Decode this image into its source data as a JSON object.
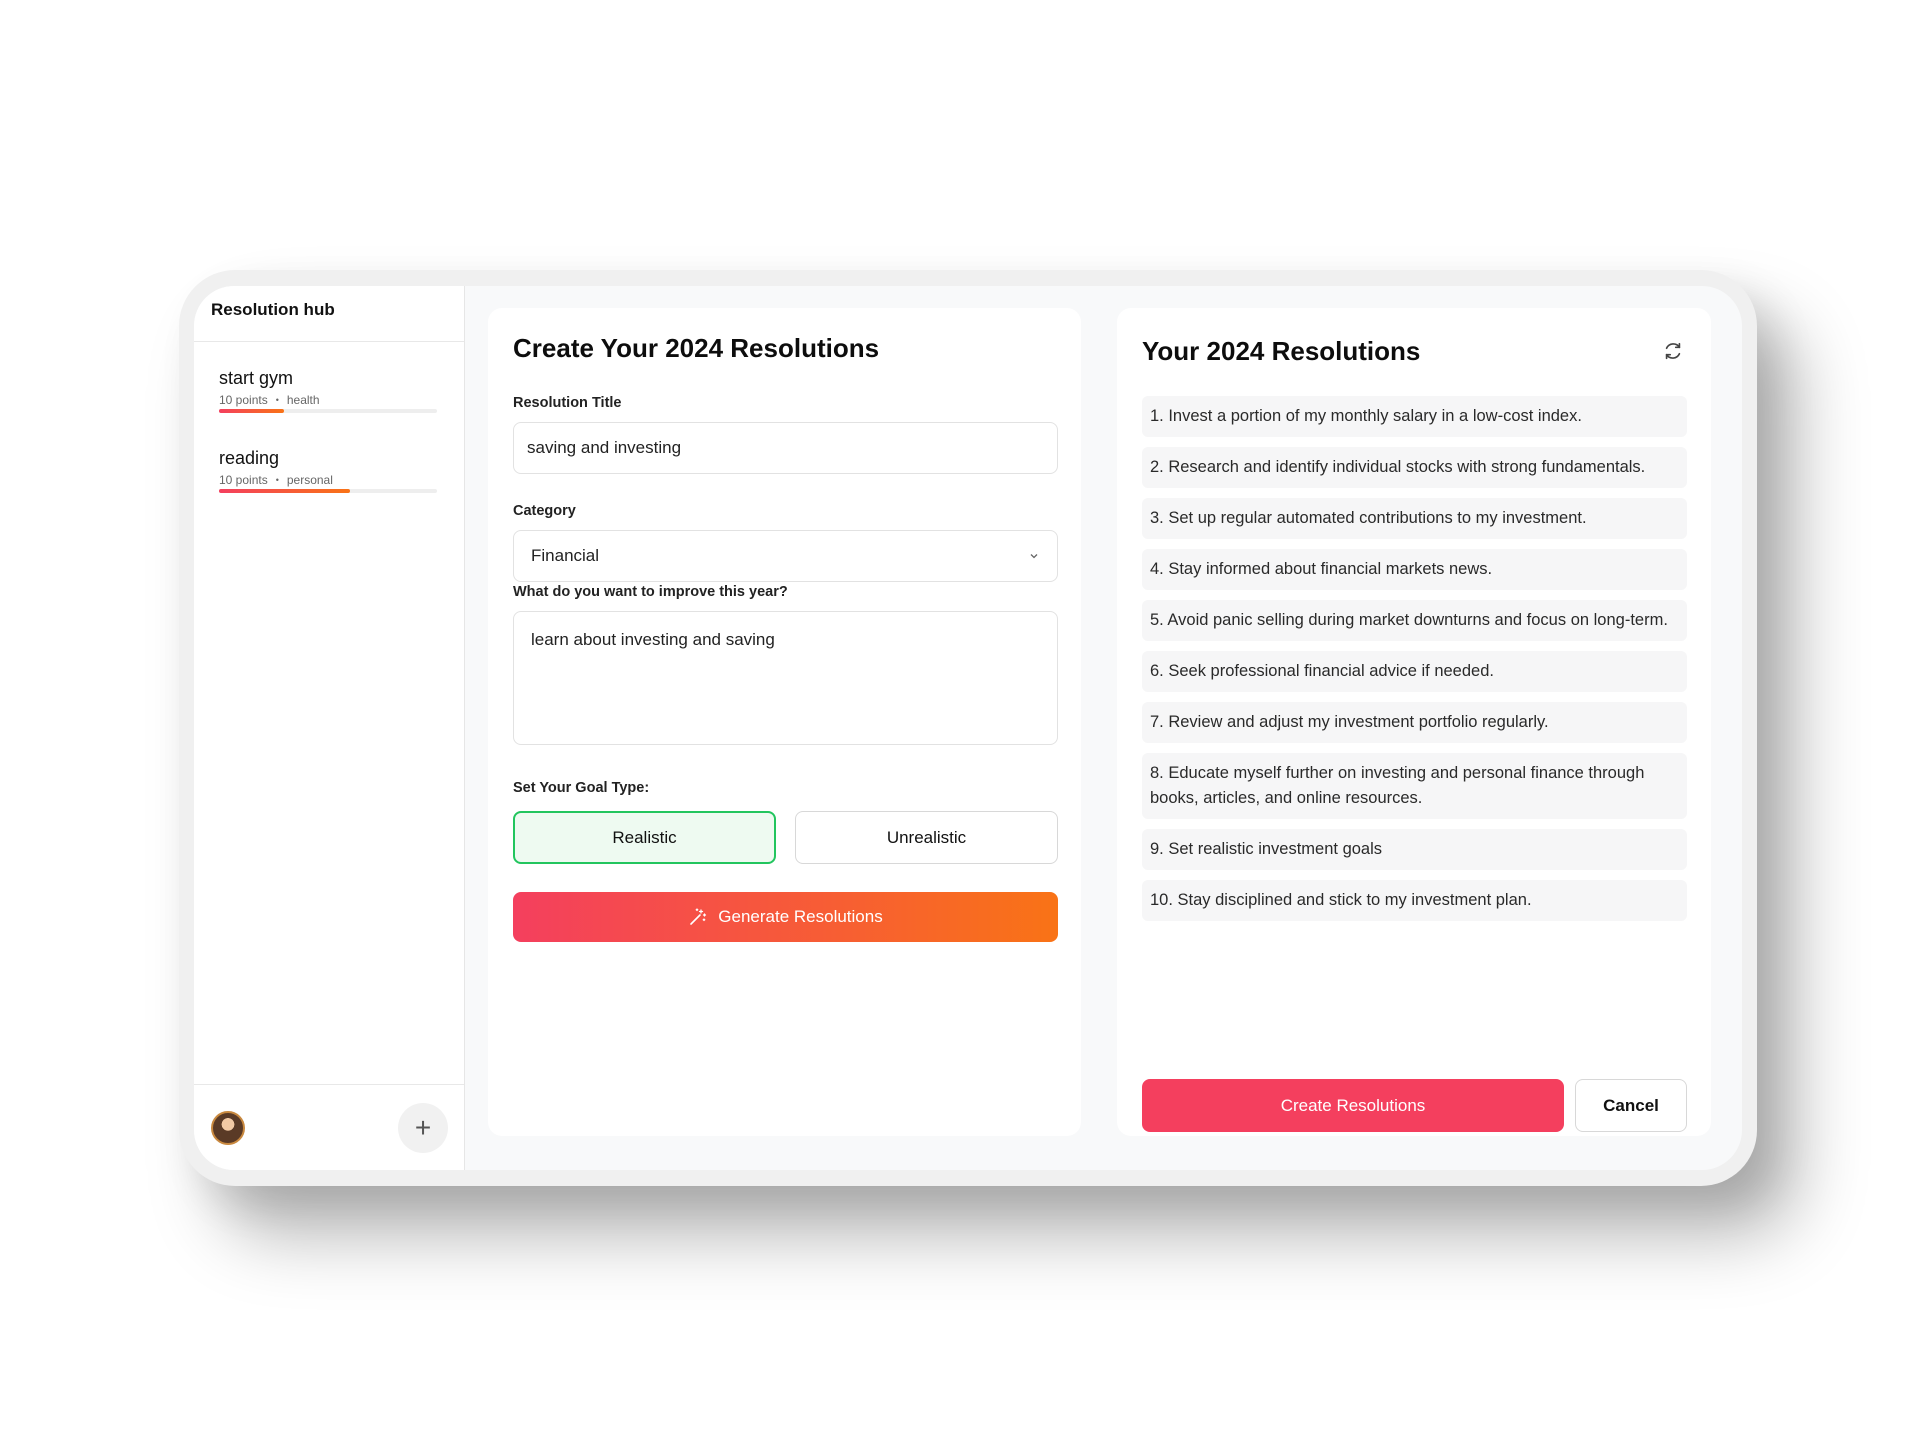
{
  "sidebar": {
    "title": "Resolution hub",
    "items": [
      {
        "name": "start gym",
        "points": "10 points",
        "separator": "•",
        "category": "health",
        "progress": 0.3
      },
      {
        "name": "reading",
        "points": "10 points",
        "separator": "•",
        "category": "personal",
        "progress": 0.6
      }
    ],
    "add_label": "+"
  },
  "form": {
    "heading": "Create Your 2024 Resolutions",
    "title_label": "Resolution Title",
    "title_value": "saving and investing",
    "category_label": "Category",
    "category_value": "Financial",
    "improve_label": "What do you want to improve this year?",
    "improve_value": "learn about investing and saving",
    "goal_type_label": "Set Your Goal Type:",
    "goal_options": [
      "Realistic",
      "Unrealistic"
    ],
    "goal_selected": "Realistic",
    "generate_label": "Generate Resolutions"
  },
  "results": {
    "heading": "Your 2024 Resolutions",
    "items": [
      "1. Invest a portion of my monthly salary in a low-cost index.",
      "2. Research and identify individual stocks with strong fundamentals.",
      "3. Set up regular automated contributions to my investment.",
      "4. Stay informed about financial markets news.",
      "5. Avoid panic selling during market downturns and focus on long-term.",
      "6. Seek professional financial advice if needed.",
      "7. Review and adjust my investment portfolio regularly.",
      "8. Educate myself further on investing and personal finance through books, articles, and online resources.",
      "9. Set realistic investment goals",
      "10. Stay disciplined and stick to my investment plan."
    ],
    "create_label": "Create Resolutions",
    "cancel_label": "Cancel"
  },
  "colors": {
    "accent": "#f43f5e",
    "accent_gradient_end": "#f97316",
    "selected_green": "#22c55e"
  }
}
